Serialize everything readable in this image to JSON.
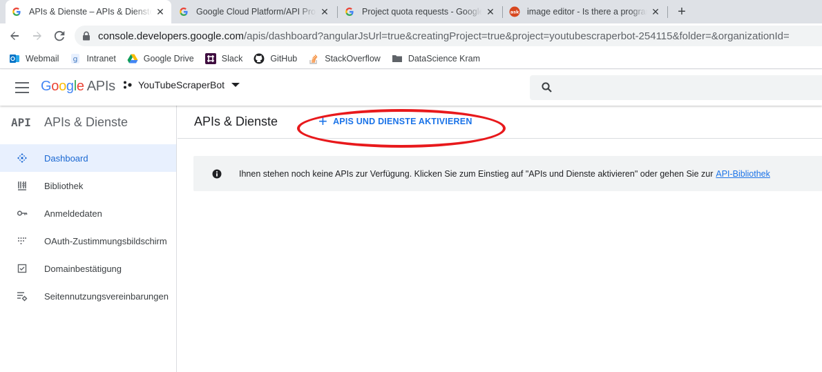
{
  "browser": {
    "tabs": [
      {
        "title": "APIs & Dienste – APIs & Dienste",
        "active": true,
        "favicon": "google-g-icon"
      },
      {
        "title": "Google Cloud Platform/API Project",
        "active": false,
        "favicon": "google-g-icon"
      },
      {
        "title": "Project quota requests - Google",
        "active": false,
        "favicon": "google-g-icon"
      },
      {
        "title": "image editor - Is there a program",
        "active": false,
        "favicon": "askubuntu-icon"
      }
    ],
    "close_glyph": "✕",
    "newtab_glyph": "+",
    "url_host": "console.developers.google.com",
    "url_path": "/apis/dashboard?angularJsUrl=true&creatingProject=true&project=youtubescraperbot-254115&folder=&organizationId="
  },
  "bookmarks": [
    {
      "label": "Webmail",
      "icon": "outlook-icon"
    },
    {
      "label": "Intranet",
      "icon": "intranet-icon"
    },
    {
      "label": "Google Drive",
      "icon": "google-drive-icon"
    },
    {
      "label": "Slack",
      "icon": "slack-icon"
    },
    {
      "label": "GitHub",
      "icon": "github-icon"
    },
    {
      "label": "StackOverflow",
      "icon": "stackoverflow-icon"
    },
    {
      "label": "DataScience Kram",
      "icon": "folder-icon"
    }
  ],
  "header": {
    "logo_letters": [
      "G",
      "o",
      "o",
      "g",
      "l",
      "e"
    ],
    "logo_suffix": "APIs",
    "project_name": "YouTubeScraperBot",
    "search_placeholder": ""
  },
  "sidebar": {
    "mark": "API",
    "title": "APIs & Dienste",
    "items": [
      {
        "label": "Dashboard",
        "icon": "dashboard-icon",
        "active": true
      },
      {
        "label": "Bibliothek",
        "icon": "library-icon",
        "active": false
      },
      {
        "label": "Anmeldedaten",
        "icon": "key-icon",
        "active": false
      },
      {
        "label": "OAuth-Zustimmungsbildschirm",
        "icon": "oauth-icon",
        "active": false
      },
      {
        "label": "Domainbestätigung",
        "icon": "checkbox-icon",
        "active": false
      },
      {
        "label": "Seitennutzungsvereinbarungen",
        "icon": "settings-list-icon",
        "active": false
      }
    ]
  },
  "main": {
    "title": "APIs & Dienste",
    "enable_button": {
      "plus": "+",
      "label": "APIS UND DIENSTE AKTIVIEREN"
    },
    "info_text": "Ihnen stehen noch keine APIs zur Verfügung. Klicken Sie zum Einstieg auf \"APIs und Dienste aktivieren\" oder gehen Sie zur",
    "info_link": "API-Bibliothek"
  },
  "colors": {
    "accent": "#1a73e8",
    "active_nav_bg": "#e8f0fe",
    "annotation": "#e8191c"
  }
}
